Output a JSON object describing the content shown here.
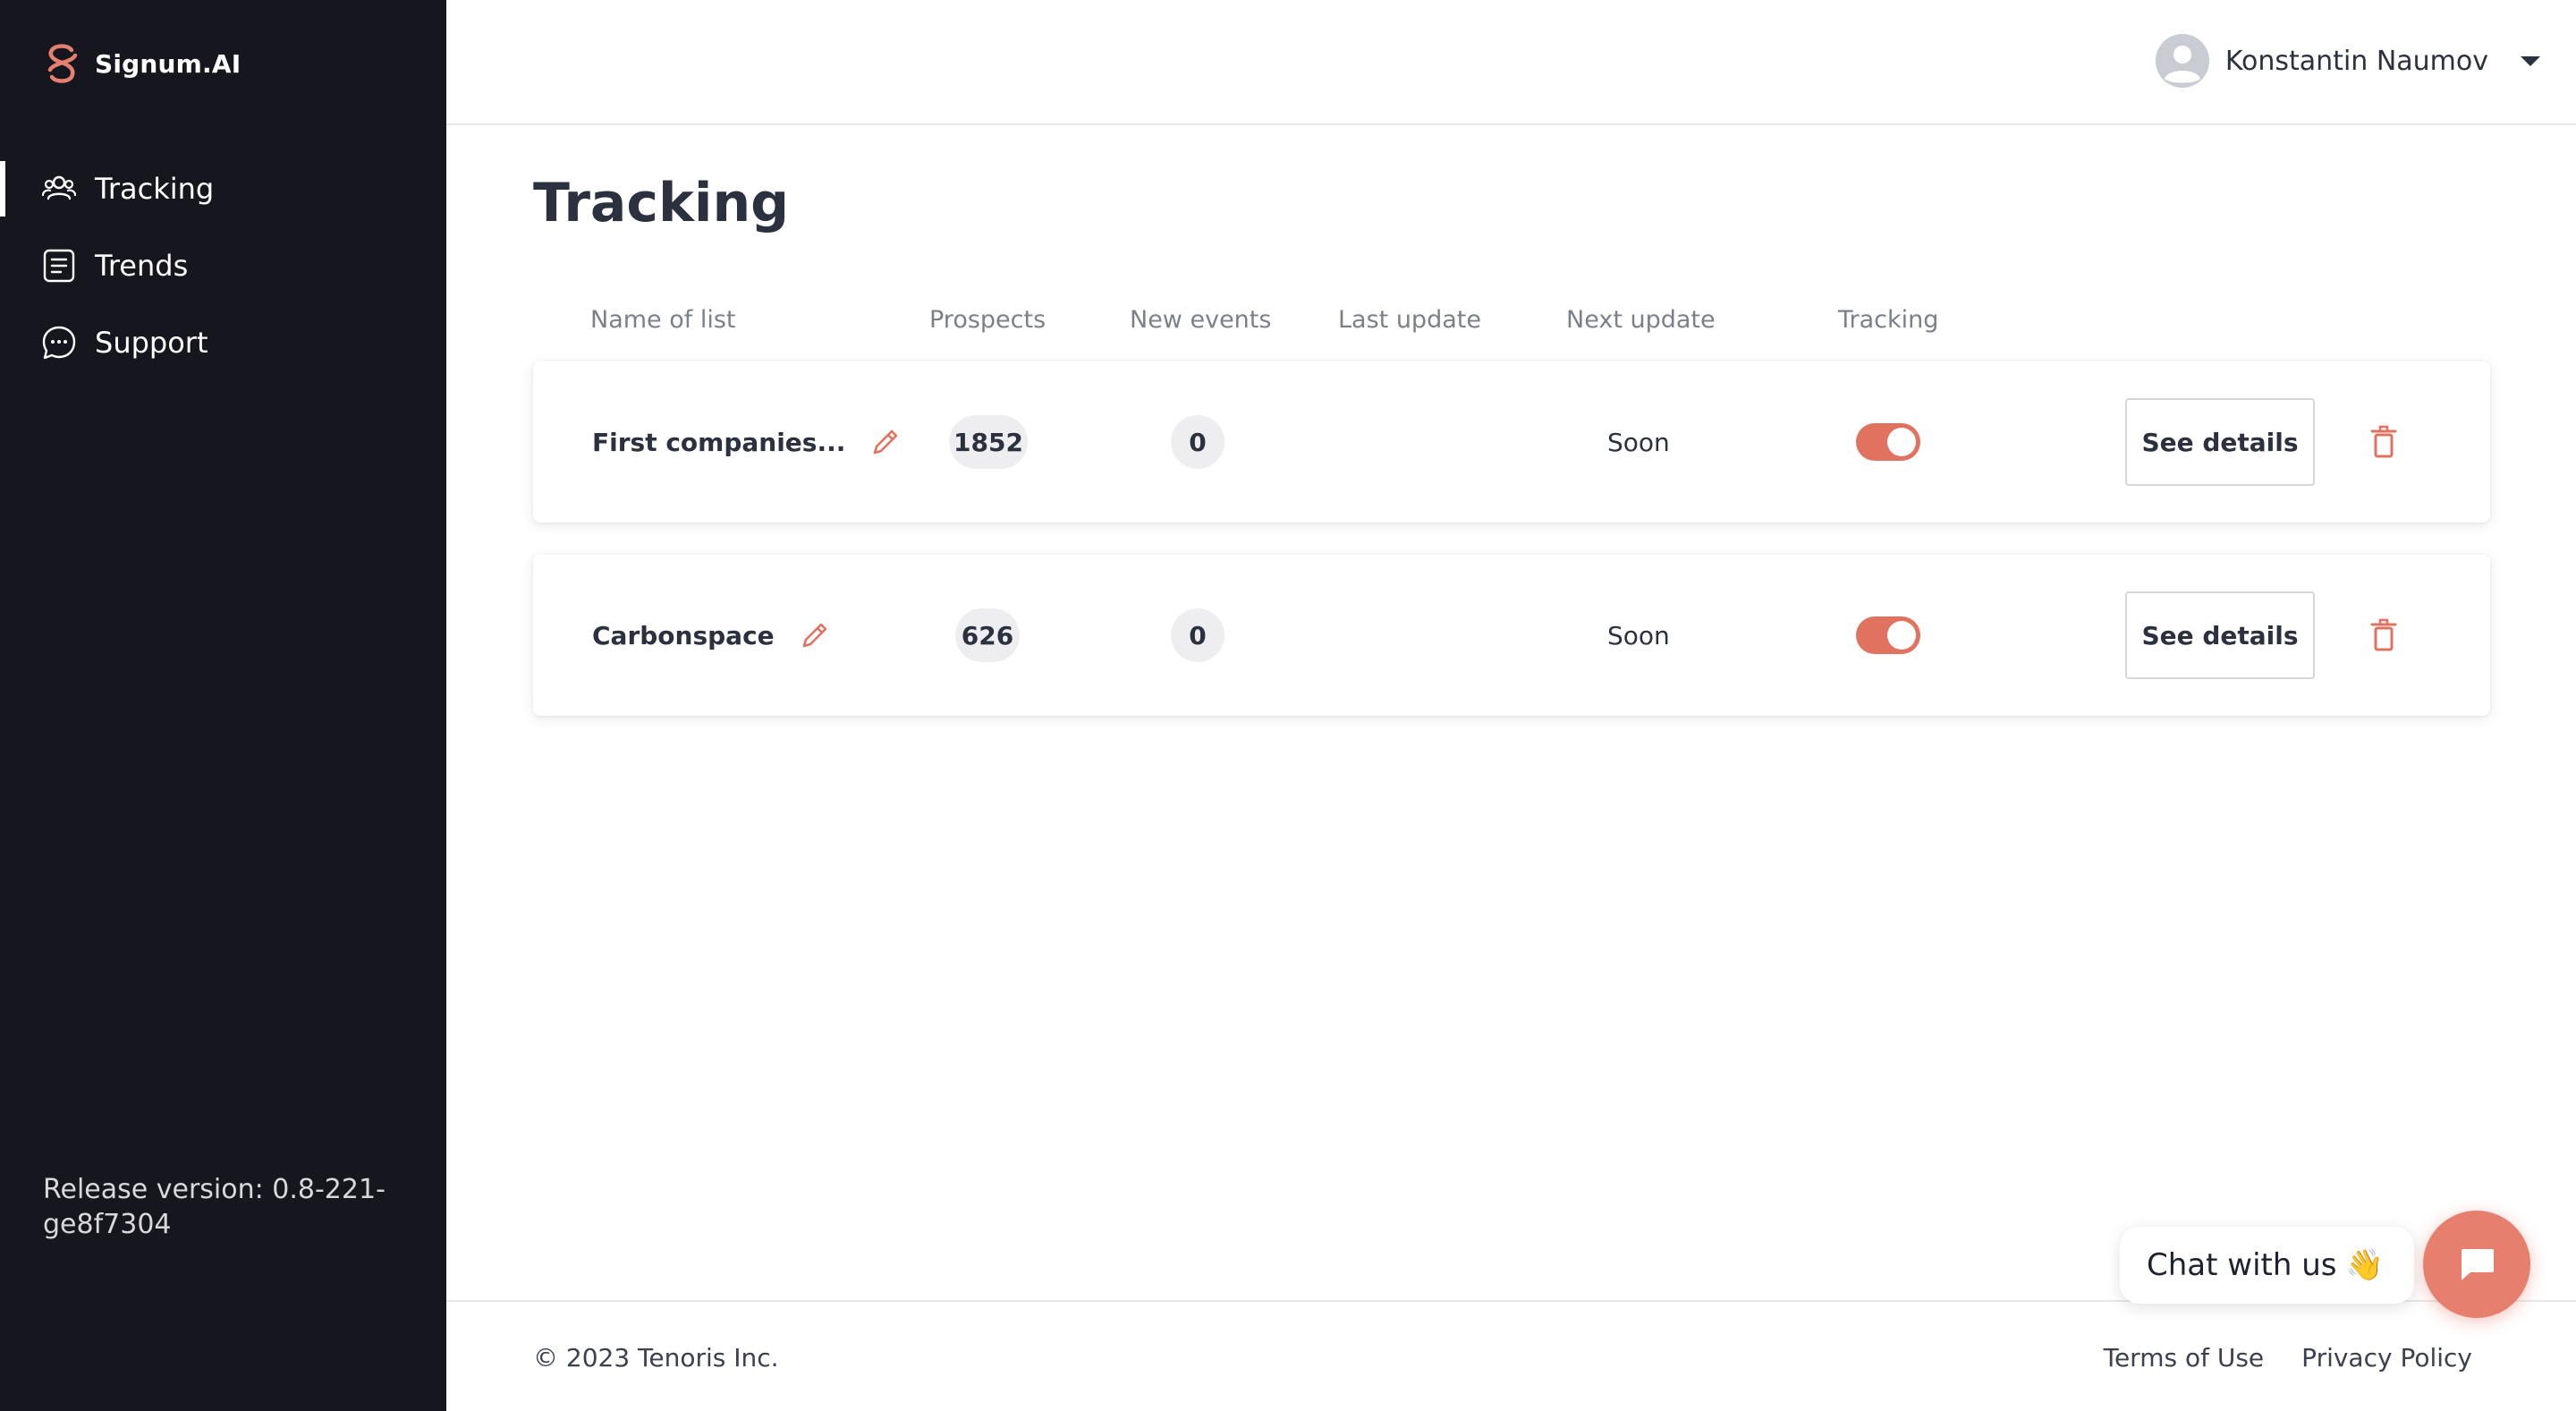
{
  "brand": {
    "name": "Signum.AI",
    "accent": "#e0725f"
  },
  "sidebar": {
    "items": [
      {
        "label": "Tracking",
        "icon": "users-icon",
        "active": true
      },
      {
        "label": "Trends",
        "icon": "document-icon",
        "active": false
      },
      {
        "label": "Support",
        "icon": "chat-icon",
        "active": false
      }
    ],
    "release": "Release version: 0.8-221-ge8f7304"
  },
  "header": {
    "user_name": "Konstantin Naumov"
  },
  "main": {
    "title": "Tracking",
    "columns": [
      "Name of list",
      "Prospects",
      "New events",
      "Last update",
      "Next update",
      "Tracking"
    ],
    "rows": [
      {
        "name": "First companies...",
        "prospects": "1852",
        "new_events": "0",
        "last_update": "",
        "next_update": "Soon",
        "tracking": true,
        "details_label": "See details"
      },
      {
        "name": "Carbonspace",
        "prospects": "626",
        "new_events": "0",
        "last_update": "",
        "next_update": "Soon",
        "tracking": true,
        "details_label": "See details"
      }
    ]
  },
  "footer": {
    "copyright": "© 2023 Tenoris Inc.",
    "links": [
      "Terms of Use",
      "Privacy Policy"
    ]
  },
  "chat": {
    "label": "Chat with us",
    "emoji": "👋"
  }
}
